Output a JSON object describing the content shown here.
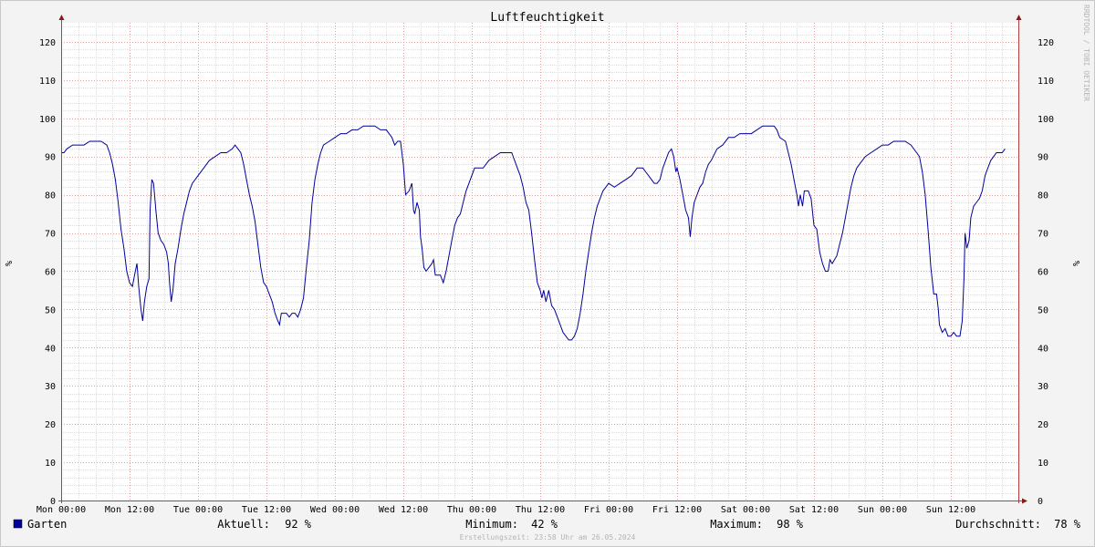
{
  "chart_data": {
    "type": "line",
    "title": "Luftfeuchtigkeit",
    "ylabel": "%",
    "ylabel_right": "%",
    "ylim": [
      0,
      125
    ],
    "y_ticks": [
      0,
      10,
      20,
      30,
      40,
      50,
      60,
      70,
      80,
      90,
      100,
      110,
      120
    ],
    "x_ticks": [
      "Mon 00:00",
      "Mon 12:00",
      "Tue 00:00",
      "Tue 12:00",
      "Wed 00:00",
      "Wed 12:00",
      "Thu 00:00",
      "Thu 12:00",
      "Fri 00:00",
      "Fri 12:00",
      "Sat 00:00",
      "Sat 12:00",
      "Sun 00:00",
      "Sun 12:00"
    ],
    "x_unit": "hours since Mon 00:00",
    "xlim": [
      0,
      168
    ],
    "grid": true,
    "watermark": "RRDTOOL / TOBI OETIKER",
    "footer": "Erstellungszeit: 23:58 Uhr am 26.05.2024",
    "series": [
      {
        "name": "Garten",
        "color": "#00009c",
        "points": [
          [
            0,
            91
          ],
          [
            0.5,
            91
          ],
          [
            1,
            92
          ],
          [
            2,
            93
          ],
          [
            3,
            93
          ],
          [
            4,
            93
          ],
          [
            5,
            94
          ],
          [
            6,
            94
          ],
          [
            7,
            94
          ],
          [
            8,
            93
          ],
          [
            8.5,
            91
          ],
          [
            9,
            88
          ],
          [
            9.5,
            84
          ],
          [
            10,
            78
          ],
          [
            10.5,
            71
          ],
          [
            11,
            66
          ],
          [
            11.5,
            60
          ],
          [
            12,
            57
          ],
          [
            12.5,
            56
          ],
          [
            13,
            60
          ],
          [
            13.3,
            62
          ],
          [
            13.6,
            56
          ],
          [
            14,
            50
          ],
          [
            14.3,
            47
          ],
          [
            14.6,
            52
          ],
          [
            15,
            56
          ],
          [
            15.4,
            58
          ],
          [
            15.6,
            76
          ],
          [
            15.9,
            84
          ],
          [
            16.2,
            83
          ],
          [
            16.6,
            76
          ],
          [
            17,
            70
          ],
          [
            17.5,
            68
          ],
          [
            18,
            67
          ],
          [
            18.5,
            65
          ],
          [
            18.8,
            62
          ],
          [
            19,
            57
          ],
          [
            19.3,
            52
          ],
          [
            19.6,
            55
          ],
          [
            20,
            62
          ],
          [
            20.5,
            66
          ],
          [
            21,
            71
          ],
          [
            21.5,
            75
          ],
          [
            22,
            78
          ],
          [
            22.5,
            81
          ],
          [
            23,
            83
          ],
          [
            24,
            85
          ],
          [
            25,
            87
          ],
          [
            26,
            89
          ],
          [
            27,
            90
          ],
          [
            28,
            91
          ],
          [
            29,
            91
          ],
          [
            30,
            92
          ],
          [
            30.5,
            93
          ],
          [
            31,
            92
          ],
          [
            31.5,
            91
          ],
          [
            32,
            88
          ],
          [
            32.5,
            84
          ],
          [
            33,
            80
          ],
          [
            33.5,
            77
          ],
          [
            34,
            73
          ],
          [
            34.5,
            67
          ],
          [
            35,
            61
          ],
          [
            35.5,
            57
          ],
          [
            36,
            56
          ],
          [
            36.5,
            54
          ],
          [
            37,
            52
          ],
          [
            37.5,
            49
          ],
          [
            38,
            47
          ],
          [
            38.3,
            46
          ],
          [
            38.6,
            49
          ],
          [
            39.5,
            49
          ],
          [
            40,
            48
          ],
          [
            40.5,
            49
          ],
          [
            41,
            49
          ],
          [
            41.5,
            48
          ],
          [
            42,
            50
          ],
          [
            42.5,
            53
          ],
          [
            43,
            61
          ],
          [
            43.5,
            68
          ],
          [
            44,
            78
          ],
          [
            44.5,
            84
          ],
          [
            45,
            88
          ],
          [
            45.5,
            91
          ],
          [
            46,
            93
          ],
          [
            47,
            94
          ],
          [
            48,
            95
          ],
          [
            49,
            96
          ],
          [
            50,
            96
          ],
          [
            51,
            97
          ],
          [
            52,
            97
          ],
          [
            53,
            98
          ],
          [
            55,
            98
          ],
          [
            56,
            97
          ],
          [
            57,
            97
          ],
          [
            57.5,
            96
          ],
          [
            58,
            95
          ],
          [
            58.5,
            93
          ],
          [
            59,
            94
          ],
          [
            59.5,
            94
          ],
          [
            60,
            88
          ],
          [
            60.4,
            80
          ],
          [
            61,
            81
          ],
          [
            61.5,
            83
          ],
          [
            61.8,
            76
          ],
          [
            62,
            75
          ],
          [
            62.4,
            78
          ],
          [
            62.8,
            76
          ],
          [
            63,
            69
          ],
          [
            63.3,
            66
          ],
          [
            63.6,
            61
          ],
          [
            64,
            60
          ],
          [
            64.5,
            61
          ],
          [
            65,
            62
          ],
          [
            65.3,
            63
          ],
          [
            65.6,
            59
          ],
          [
            66,
            59
          ],
          [
            66.5,
            59
          ],
          [
            67,
            57
          ],
          [
            67.5,
            60
          ],
          [
            68,
            64
          ],
          [
            68.5,
            68
          ],
          [
            69,
            72
          ],
          [
            69.5,
            74
          ],
          [
            70,
            75
          ],
          [
            70.5,
            78
          ],
          [
            71,
            81
          ],
          [
            71.5,
            83
          ],
          [
            72,
            85
          ],
          [
            72.5,
            87
          ],
          [
            73,
            87
          ],
          [
            74,
            87
          ],
          [
            75,
            89
          ],
          [
            76,
            90
          ],
          [
            77,
            91
          ],
          [
            79,
            91
          ],
          [
            79.5,
            89
          ],
          [
            80,
            87
          ],
          [
            80.5,
            85
          ],
          [
            81,
            82
          ],
          [
            81.5,
            78
          ],
          [
            82,
            76
          ],
          [
            82.5,
            70
          ],
          [
            83,
            63
          ],
          [
            83.5,
            57
          ],
          [
            84,
            55
          ],
          [
            84.3,
            53
          ],
          [
            84.6,
            55
          ],
          [
            85,
            52
          ],
          [
            85.5,
            55
          ],
          [
            86,
            51
          ],
          [
            86.5,
            50
          ],
          [
            87,
            48
          ],
          [
            87.5,
            46
          ],
          [
            88,
            44
          ],
          [
            88.5,
            43
          ],
          [
            89,
            42
          ],
          [
            89.5,
            42
          ],
          [
            90,
            43
          ],
          [
            90.5,
            45
          ],
          [
            91,
            49
          ],
          [
            91.5,
            54
          ],
          [
            92,
            60
          ],
          [
            92.5,
            65
          ],
          [
            93,
            70
          ],
          [
            93.5,
            74
          ],
          [
            94,
            77
          ],
          [
            94.5,
            79
          ],
          [
            95,
            81
          ],
          [
            95.5,
            82
          ],
          [
            96,
            83
          ],
          [
            97,
            82
          ],
          [
            98,
            83
          ],
          [
            99,
            84
          ],
          [
            100,
            85
          ],
          [
            101,
            87
          ],
          [
            102,
            87
          ],
          [
            102.5,
            86
          ],
          [
            103,
            85
          ],
          [
            103.5,
            84
          ],
          [
            104,
            83
          ],
          [
            104.5,
            83
          ],
          [
            105,
            84
          ],
          [
            105.5,
            87
          ],
          [
            106,
            89
          ],
          [
            106.5,
            91
          ],
          [
            107,
            92
          ],
          [
            107.4,
            90
          ],
          [
            107.8,
            86
          ],
          [
            108,
            87
          ],
          [
            108.5,
            84
          ],
          [
            109,
            80
          ],
          [
            109.5,
            76
          ],
          [
            110,
            74
          ],
          [
            110.3,
            69
          ],
          [
            110.6,
            74
          ],
          [
            111,
            78
          ],
          [
            111.5,
            80
          ],
          [
            112,
            82
          ],
          [
            112.5,
            83
          ],
          [
            113,
            86
          ],
          [
            113.5,
            88
          ],
          [
            114,
            89
          ],
          [
            115,
            92
          ],
          [
            116,
            93
          ],
          [
            117,
            95
          ],
          [
            118,
            95
          ],
          [
            119,
            96
          ],
          [
            120,
            96
          ],
          [
            121,
            96
          ],
          [
            122,
            97
          ],
          [
            123,
            98
          ],
          [
            124,
            98
          ],
          [
            125,
            98
          ],
          [
            125.5,
            97
          ],
          [
            126,
            95
          ],
          [
            127,
            94
          ],
          [
            127.5,
            91
          ],
          [
            128,
            88
          ],
          [
            128.5,
            84
          ],
          [
            129,
            80
          ],
          [
            129.3,
            77
          ],
          [
            129.6,
            80
          ],
          [
            130,
            77
          ],
          [
            130.3,
            81
          ],
          [
            131,
            81
          ],
          [
            131.5,
            79
          ],
          [
            132,
            72
          ],
          [
            132.5,
            71
          ],
          [
            133,
            65
          ],
          [
            133.5,
            62
          ],
          [
            134,
            60
          ],
          [
            134.5,
            60
          ],
          [
            134.8,
            63
          ],
          [
            135.2,
            62
          ],
          [
            135.6,
            63
          ],
          [
            136,
            64
          ],
          [
            136.5,
            67
          ],
          [
            137,
            70
          ],
          [
            137.5,
            74
          ],
          [
            138,
            78
          ],
          [
            138.5,
            82
          ],
          [
            139,
            85
          ],
          [
            139.5,
            87
          ],
          [
            140,
            88
          ],
          [
            141,
            90
          ],
          [
            142,
            91
          ],
          [
            143,
            92
          ],
          [
            144,
            93
          ],
          [
            145,
            93
          ],
          [
            146,
            94
          ],
          [
            148,
            94
          ],
          [
            149,
            93
          ],
          [
            150,
            91
          ],
          [
            150.5,
            90
          ],
          [
            151,
            86
          ],
          [
            151.5,
            80
          ],
          [
            152,
            71
          ],
          [
            152.5,
            61
          ],
          [
            153,
            54
          ],
          [
            153.5,
            54
          ],
          [
            153.8,
            50
          ],
          [
            154,
            46
          ],
          [
            154.5,
            44
          ],
          [
            155,
            45
          ],
          [
            155.5,
            43
          ],
          [
            156,
            43
          ],
          [
            156.5,
            44
          ],
          [
            157,
            43
          ],
          [
            157.6,
            43
          ],
          [
            158,
            47
          ],
          [
            158.3,
            58
          ],
          [
            158.5,
            70
          ],
          [
            158.8,
            66
          ],
          [
            159.2,
            68
          ],
          [
            159.5,
            74
          ],
          [
            160,
            77
          ],
          [
            160.5,
            78
          ],
          [
            161,
            79
          ],
          [
            161.5,
            81
          ],
          [
            162,
            85
          ],
          [
            162.5,
            87
          ],
          [
            163,
            89
          ],
          [
            163.5,
            90
          ],
          [
            164,
            91
          ],
          [
            164.5,
            91
          ],
          [
            165,
            91
          ],
          [
            165.5,
            92
          ]
        ]
      }
    ],
    "legend": {
      "series_name": "Garten",
      "current_label": "Aktuell:",
      "current_value": "92 %",
      "min_label": "Minimum:",
      "min_value": "42 %",
      "max_label": "Maximum:",
      "max_value": "98 %",
      "avg_label": "Durchschnitt:",
      "avg_value": "78 %"
    }
  }
}
